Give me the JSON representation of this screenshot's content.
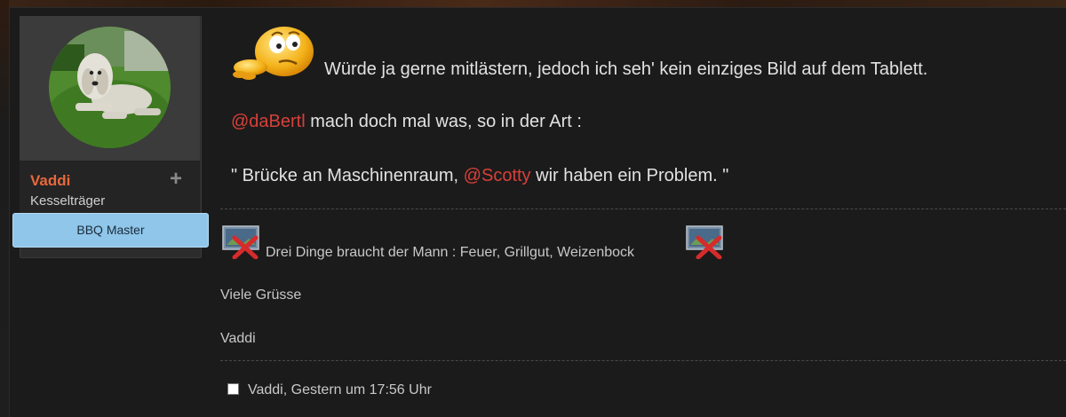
{
  "user": {
    "name": "Vaddi",
    "title": "Kesselträger",
    "banner": "BBQ Master",
    "avatar_icon": "dog-avatar",
    "plus_label": "+"
  },
  "post": {
    "line1": "Würde ja gerne mitlästern, jedoch ich seh' kein einziges Bild auf dem Tablett.",
    "line2_mention": "@daBertl",
    "line2_text": " mach doch mal was, so in der Art :",
    "line3_pre": "\" Brücke an Maschinenraum, ",
    "line3_mention": "@Scotty",
    "line3_post": " wir haben ein Problem. \""
  },
  "signature": {
    "line1": "Drei Dinge braucht der Mann : Feuer, Grillgut, Weizenbock",
    "greeting": "Viele Grüsse",
    "name": "Vaddi"
  },
  "footer": {
    "meta": "Vaddi, Gestern um 17:56 Uhr"
  },
  "colors": {
    "username": "#e8683c",
    "mention": "#d8403a",
    "banner": "#8fc6ea"
  }
}
